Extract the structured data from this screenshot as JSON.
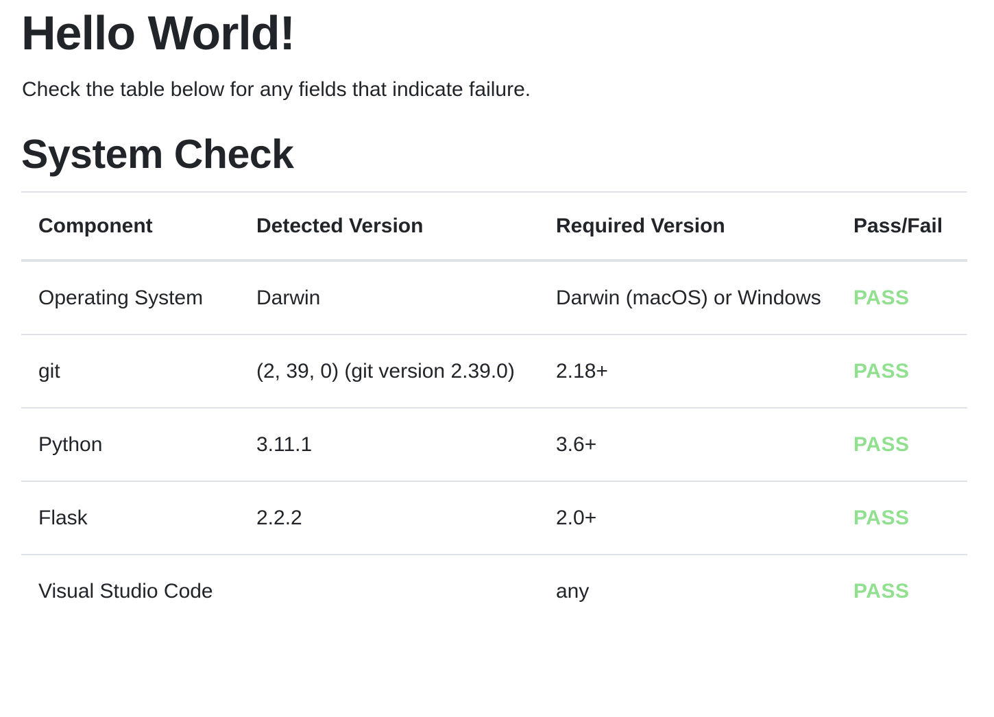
{
  "header": {
    "title": "Hello World!",
    "intro": "Check the table below for any fields that indicate failure."
  },
  "section": {
    "title": "System Check"
  },
  "table": {
    "columns": [
      "Component",
      "Detected Version",
      "Required Version",
      "Pass/Fail"
    ],
    "rows": [
      {
        "component": "Operating System",
        "detected": "Darwin",
        "required": "Darwin (macOS) or Windows",
        "status": "PASS"
      },
      {
        "component": "git",
        "detected": "(2, 39, 0) (git version 2.39.0)",
        "required": "2.18+",
        "status": "PASS"
      },
      {
        "component": "Python",
        "detected": "3.11.1",
        "required": "3.6+",
        "status": "PASS"
      },
      {
        "component": "Flask",
        "detected": "2.2.2",
        "required": "2.0+",
        "status": "PASS"
      },
      {
        "component": "Visual Studio Code",
        "detected": "",
        "required": "any",
        "status": "PASS"
      }
    ]
  },
  "colors": {
    "pass": "#90e090",
    "text": "#212529",
    "border": "#dee2e6"
  }
}
